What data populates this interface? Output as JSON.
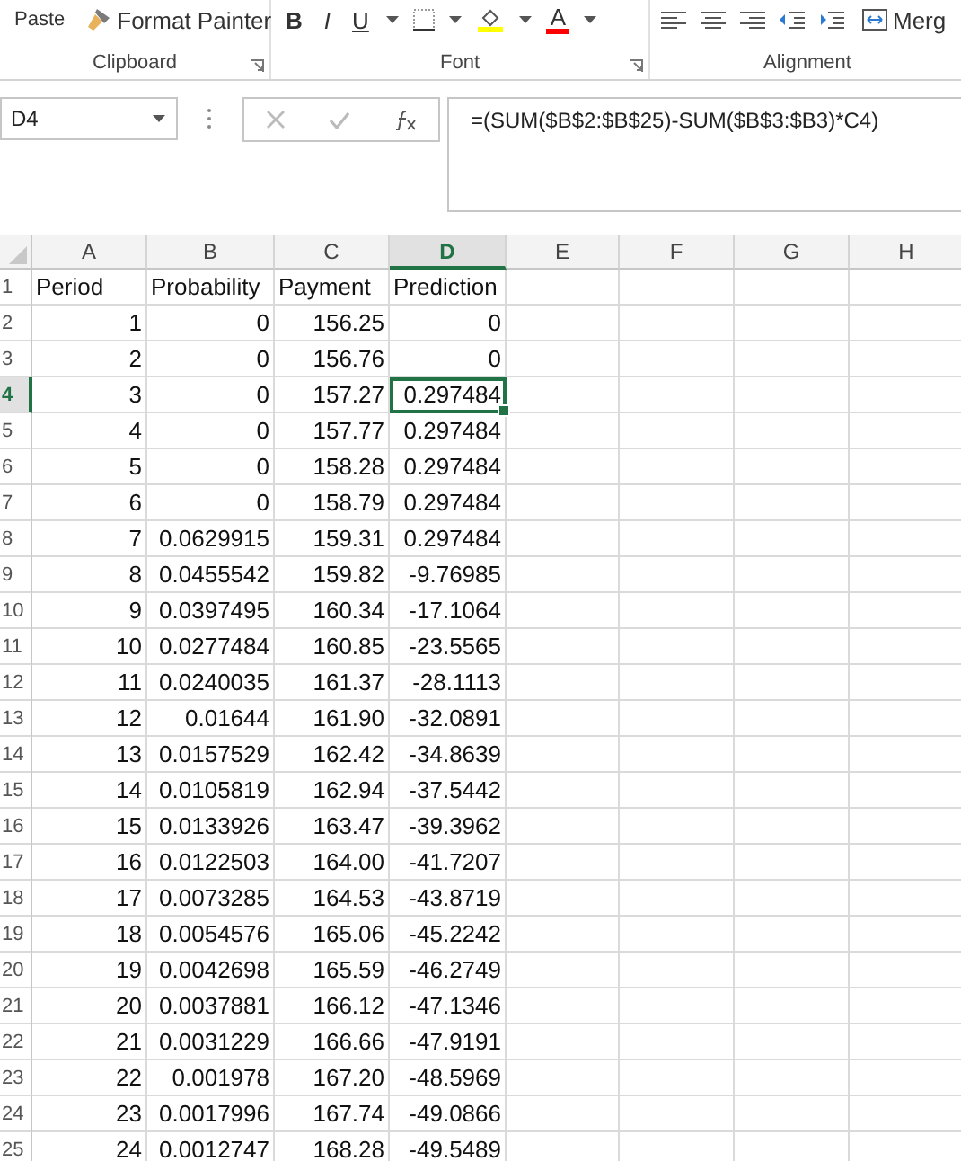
{
  "ribbon": {
    "clipboard": {
      "paste": "Paste",
      "format_painter": "Format Painter",
      "label": "Clipboard"
    },
    "font": {
      "bold": "B",
      "italic": "I",
      "underline": "U",
      "font_color": "A",
      "label": "Font"
    },
    "alignment": {
      "merge": "Merg",
      "label": "Alignment"
    }
  },
  "formula_bar": {
    "name_box": "D4",
    "formula": "=(SUM($B$2:$B$25)-SUM($B$3:$B3)*C4)"
  },
  "columns": [
    {
      "label": "A",
      "selected": false
    },
    {
      "label": "B",
      "selected": false
    },
    {
      "label": "C",
      "selected": false
    },
    {
      "label": "D",
      "selected": true
    },
    {
      "label": "E",
      "selected": false
    },
    {
      "label": "F",
      "selected": false
    },
    {
      "label": "G",
      "selected": false
    },
    {
      "label": "H",
      "selected": false
    }
  ],
  "rows": [
    {
      "number": "1",
      "kind": "labels",
      "selected": false,
      "cells": [
        "Period",
        "Probability",
        "Payment",
        "Prediction"
      ]
    },
    {
      "number": "2",
      "kind": "numbers",
      "selected": false,
      "cells": [
        "1",
        "0",
        "156.25",
        "0"
      ]
    },
    {
      "number": "3",
      "kind": "numbers",
      "selected": false,
      "cells": [
        "2",
        "0",
        "156.76",
        "0"
      ]
    },
    {
      "number": "4",
      "kind": "numbers",
      "selected": true,
      "cells": [
        "3",
        "0",
        "157.27",
        "0.297484"
      ]
    },
    {
      "number": "5",
      "kind": "numbers",
      "selected": false,
      "cells": [
        "4",
        "0",
        "157.77",
        "0.297484"
      ]
    },
    {
      "number": "6",
      "kind": "numbers",
      "selected": false,
      "cells": [
        "5",
        "0",
        "158.28",
        "0.297484"
      ]
    },
    {
      "number": "7",
      "kind": "numbers",
      "selected": false,
      "cells": [
        "6",
        "0",
        "158.79",
        "0.297484"
      ]
    },
    {
      "number": "8",
      "kind": "numbers",
      "selected": false,
      "cells": [
        "7",
        "0.0629915",
        "159.31",
        "0.297484"
      ]
    },
    {
      "number": "9",
      "kind": "numbers",
      "selected": false,
      "cells": [
        "8",
        "0.0455542",
        "159.82",
        "-9.76985"
      ]
    },
    {
      "number": "10",
      "kind": "numbers",
      "selected": false,
      "cells": [
        "9",
        "0.0397495",
        "160.34",
        "-17.1064"
      ]
    },
    {
      "number": "11",
      "kind": "numbers",
      "selected": false,
      "cells": [
        "10",
        "0.0277484",
        "160.85",
        "-23.5565"
      ]
    },
    {
      "number": "12",
      "kind": "numbers",
      "selected": false,
      "cells": [
        "11",
        "0.0240035",
        "161.37",
        "-28.1113"
      ]
    },
    {
      "number": "13",
      "kind": "numbers",
      "selected": false,
      "cells": [
        "12",
        "0.01644",
        "161.90",
        "-32.0891"
      ]
    },
    {
      "number": "14",
      "kind": "numbers",
      "selected": false,
      "cells": [
        "13",
        "0.0157529",
        "162.42",
        "-34.8639"
      ]
    },
    {
      "number": "15",
      "kind": "numbers",
      "selected": false,
      "cells": [
        "14",
        "0.0105819",
        "162.94",
        "-37.5442"
      ]
    },
    {
      "number": "16",
      "kind": "numbers",
      "selected": false,
      "cells": [
        "15",
        "0.0133926",
        "163.47",
        "-39.3962"
      ]
    },
    {
      "number": "17",
      "kind": "numbers",
      "selected": false,
      "cells": [
        "16",
        "0.0122503",
        "164.00",
        "-41.7207"
      ]
    },
    {
      "number": "18",
      "kind": "numbers",
      "selected": false,
      "cells": [
        "17",
        "0.0073285",
        "164.53",
        "-43.8719"
      ]
    },
    {
      "number": "19",
      "kind": "numbers",
      "selected": false,
      "cells": [
        "18",
        "0.0054576",
        "165.06",
        "-45.2242"
      ]
    },
    {
      "number": "20",
      "kind": "numbers",
      "selected": false,
      "cells": [
        "19",
        "0.0042698",
        "165.59",
        "-46.2749"
      ]
    },
    {
      "number": "21",
      "kind": "numbers",
      "selected": false,
      "cells": [
        "20",
        "0.0037881",
        "166.12",
        "-47.1346"
      ]
    },
    {
      "number": "22",
      "kind": "numbers",
      "selected": false,
      "cells": [
        "21",
        "0.0031229",
        "166.66",
        "-47.9191"
      ]
    },
    {
      "number": "23",
      "kind": "numbers",
      "selected": false,
      "cells": [
        "22",
        "0.001978",
        "167.20",
        "-48.5969"
      ]
    },
    {
      "number": "24",
      "kind": "numbers",
      "selected": false,
      "cells": [
        "23",
        "0.0017996",
        "167.74",
        "-49.0866"
      ]
    },
    {
      "number": "25",
      "kind": "numbers",
      "selected": false,
      "cells": [
        "24",
        "0.0012747",
        "168.28",
        "-49.5489"
      ]
    }
  ]
}
